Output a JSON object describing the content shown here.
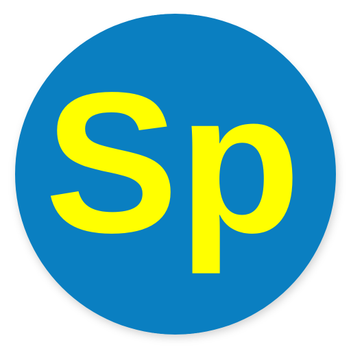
{
  "app_icon": {
    "icon_name": "sp-monogram-icon",
    "monogram": "Sp",
    "colors": {
      "background": "#0a7fc1",
      "letters": "#ffff00"
    }
  }
}
